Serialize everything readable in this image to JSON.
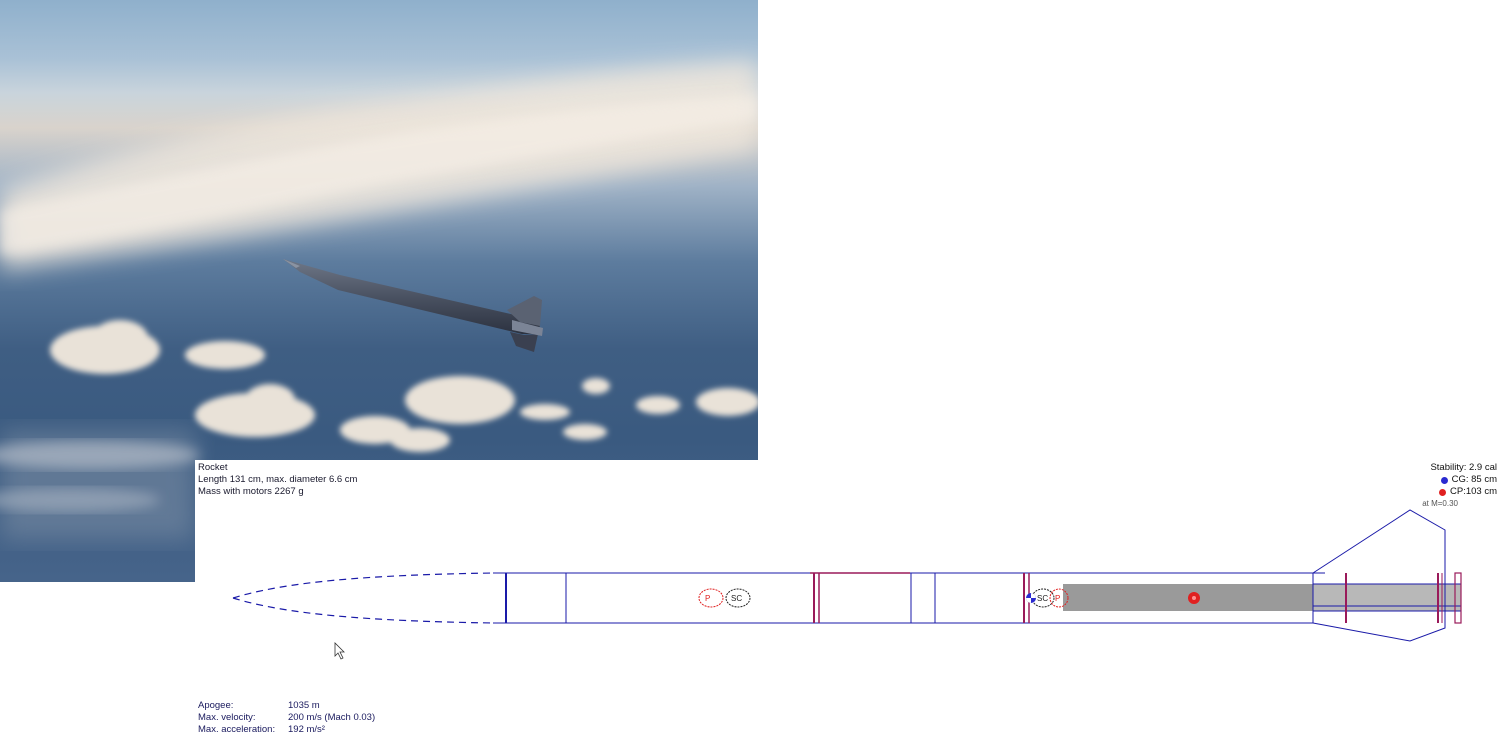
{
  "photo": {
    "subject": "rocket in flight above clouds"
  },
  "design": {
    "title": "Rocket",
    "dimensions": "Length 131 cm, max. diameter 6.6 cm",
    "mass": "Mass with motors 2267 g",
    "stability": "Stability: 2.9 cal",
    "cg": "CG: 85 cm",
    "cp": "CP:103 cm",
    "mach": "at M=0.30",
    "stats": [
      {
        "label": "Apogee:",
        "value": "1035 m"
      },
      {
        "label": "Max. velocity:",
        "value": "200 m/s  (Mach 0.03)"
      },
      {
        "label": "Max. acceleration:",
        "value": "192 m/s²"
      }
    ],
    "colors": {
      "outline": "#1a1aa8",
      "bulkhead": "#9a1a5a",
      "cp_marker": "#e02020",
      "cg_marker": "#2a2ad0",
      "motor_fill": "#9a9a9a"
    }
  }
}
